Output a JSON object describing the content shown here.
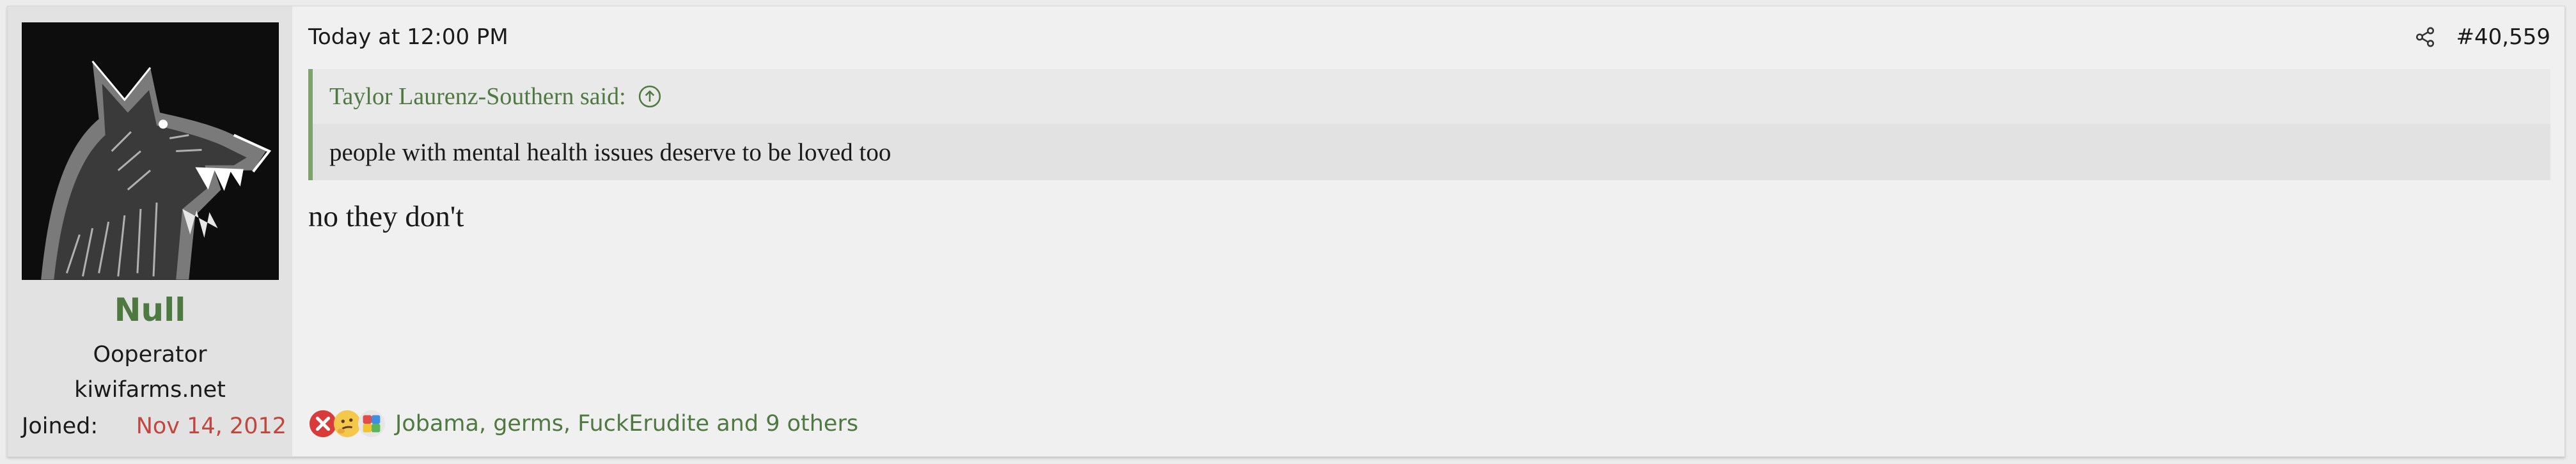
{
  "user": {
    "name": "Null",
    "title": "Ooperator",
    "banner": "kiwifarms.net",
    "joined_label": "Joined:",
    "joined_date": "Nov 14, 2012",
    "avatar_icon": "wolf-avatar-icon"
  },
  "post": {
    "date": "Today at 12:00 PM",
    "number": "#40,559",
    "share_icon": "share-icon",
    "text": "no they don't"
  },
  "quote": {
    "author": "Taylor Laurenz-Southern said:",
    "text": "people with mental health issues deserve to be loved too",
    "jump_icon": "arrow-up-circle-icon"
  },
  "reactions": {
    "icons": [
      "reaction-dumb-icon",
      "reaction-thinking-icon",
      "reaction-autism-icon"
    ],
    "summary": "Jobama, germs, FuckErudite and 9 others"
  },
  "colors": {
    "accent_green": "#4e7a41",
    "date_red": "#c2463d",
    "quote_border": "#7ea36d"
  }
}
